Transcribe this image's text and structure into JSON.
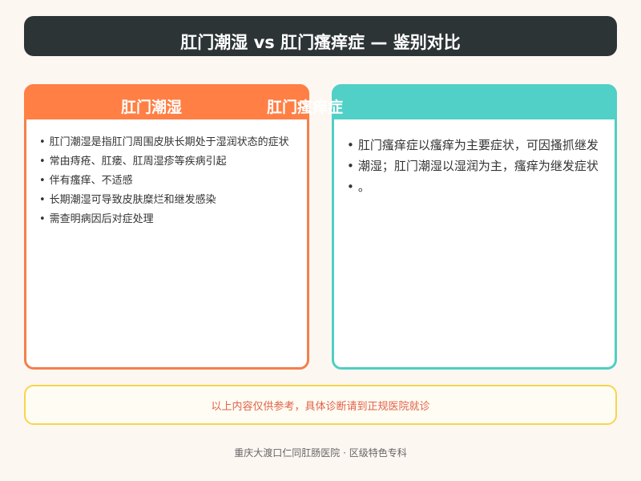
{
  "page": {
    "title": "肛门潮湿 vs 肛门瘙痒症 — 鉴别对比"
  },
  "left_panel": {
    "header": "肛门潮湿",
    "items": [
      "肛门潮湿是指肛门周围皮肤长期处于湿润状态的症状",
      "常由痔疮、肛瘘、肛周湿疹等疾病引起",
      "伴有瘙痒、不适感",
      "长期潮湿可导致皮肤糜烂和继发感染",
      "需查明病因后对症处理"
    ]
  },
  "right_panel": {
    "header": "肛门瘙痒症",
    "items": [
      "肛门瘙痒症以瘙痒为主要症状，可因搔抓继发",
      "潮湿；肛门潮湿以湿润为主，瘙痒为继发症状",
      "。"
    ]
  },
  "notice": {
    "text": "以上内容仅供参考，具体诊断请到正规医院就诊"
  },
  "footer": {
    "text": "重庆大渡口仁同肛肠医院 · 区级特色专科"
  },
  "colors": {
    "title_bar": "#2d3436",
    "left_accent": "#ff7f45",
    "right_accent": "#50d0c6",
    "notice_border": "#f7d54a",
    "notice_text": "#e1614a",
    "background": "#fdf7f2"
  }
}
